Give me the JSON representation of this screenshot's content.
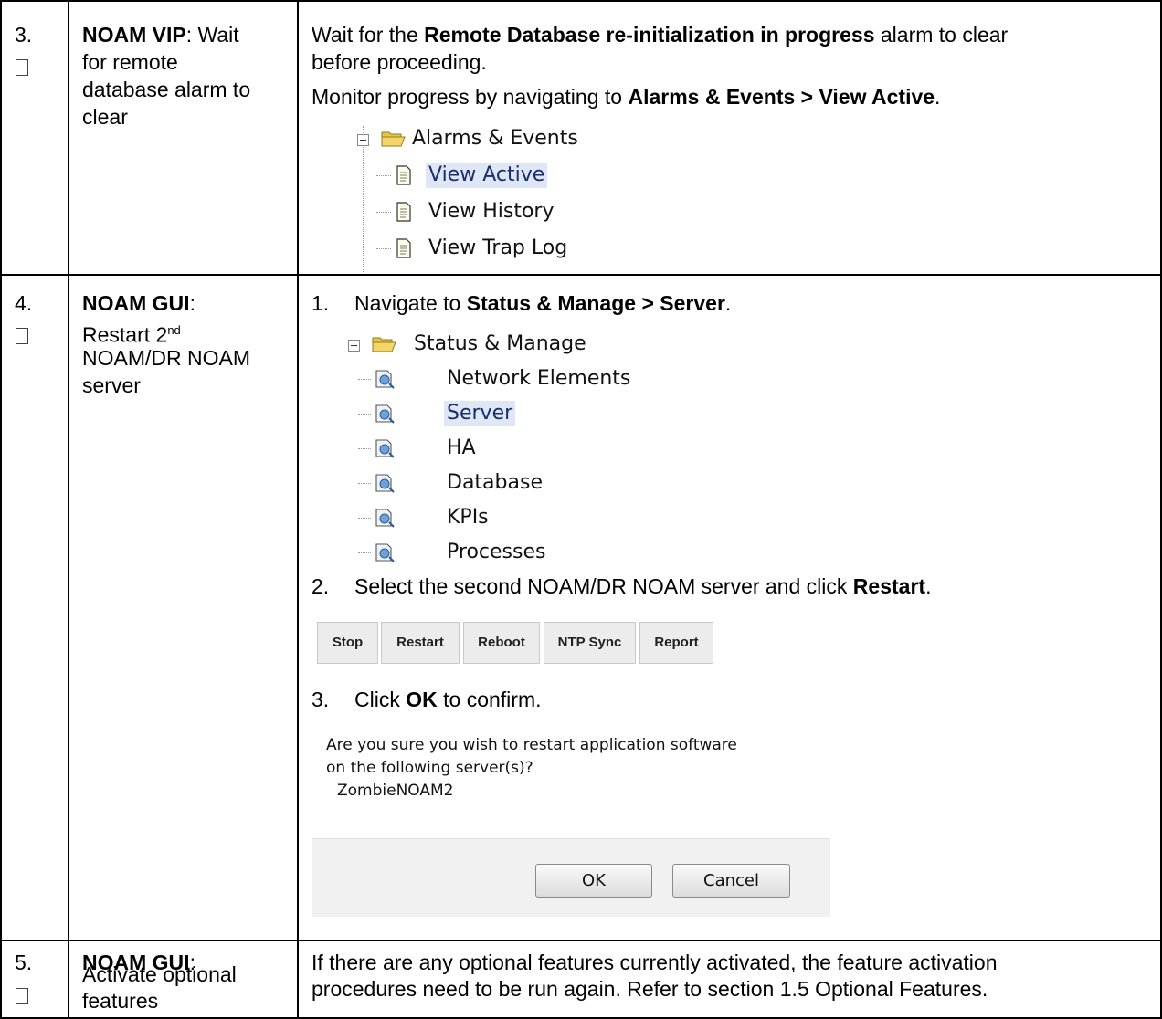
{
  "rows": [
    {
      "number": "3.",
      "step_title": "NOAM VIP",
      "step_desc_lines": [
        ": Wait",
        "for remote",
        "database alarm to",
        "clear"
      ],
      "instr1": {
        "pre": "Wait for the ",
        "bold": "Remote Database re-initialization in progress",
        "post": " alarm to clear"
      },
      "instr1_line2": "before proceeding.",
      "instr2": {
        "pre": "Monitor progress by navigating to ",
        "bold": "Alarms & Events > View Active",
        "post": "."
      },
      "tree": {
        "folder": "Alarms & Events",
        "items": [
          "View Active",
          "View History",
          "View Trap Log"
        ],
        "selected": "View Active"
      }
    },
    {
      "number": "4.",
      "step_title": "NOAM GUI",
      "step_desc": {
        "after_title": ":",
        "line2_pre": "Restart 2",
        "line2_sup": "nd",
        "line3": "NOAM/DR NOAM",
        "line4": "server"
      },
      "sub1": {
        "num": "1.",
        "pre": "Navigate to ",
        "bold": "Status & Manage > Server",
        "post": "."
      },
      "tree": {
        "folder": "Status & Manage",
        "items": [
          "Network Elements",
          "Server",
          "HA",
          "Database",
          "KPIs",
          "Processes"
        ],
        "selected": "Server"
      },
      "sub2": {
        "num": "2.",
        "pre": "Select the second NOAM/DR NOAM server and click ",
        "bold": "Restart",
        "post": "."
      },
      "buttons": [
        "Stop",
        "Restart",
        "Reboot",
        "NTP Sync",
        "Report"
      ],
      "sub3": {
        "num": "3.",
        "pre": "Click ",
        "bold": "OK",
        "post": " to confirm."
      },
      "dialog": {
        "lines": [
          "Are you sure you wish to restart application software",
          "on the following server(s)?",
          "ZombieNOAM2"
        ],
        "ok": "OK",
        "cancel": "Cancel"
      }
    },
    {
      "number": "5.",
      "step_title": "NOAM GUI",
      "step_desc": {
        "after_title": ":",
        "lines": [
          "Activate optional",
          "features"
        ]
      },
      "instr_lines": [
        "If there are any optional features currently activated, the feature activation",
        "procedures need to be run again.  Refer to section 1.5 Optional Features."
      ]
    }
  ]
}
